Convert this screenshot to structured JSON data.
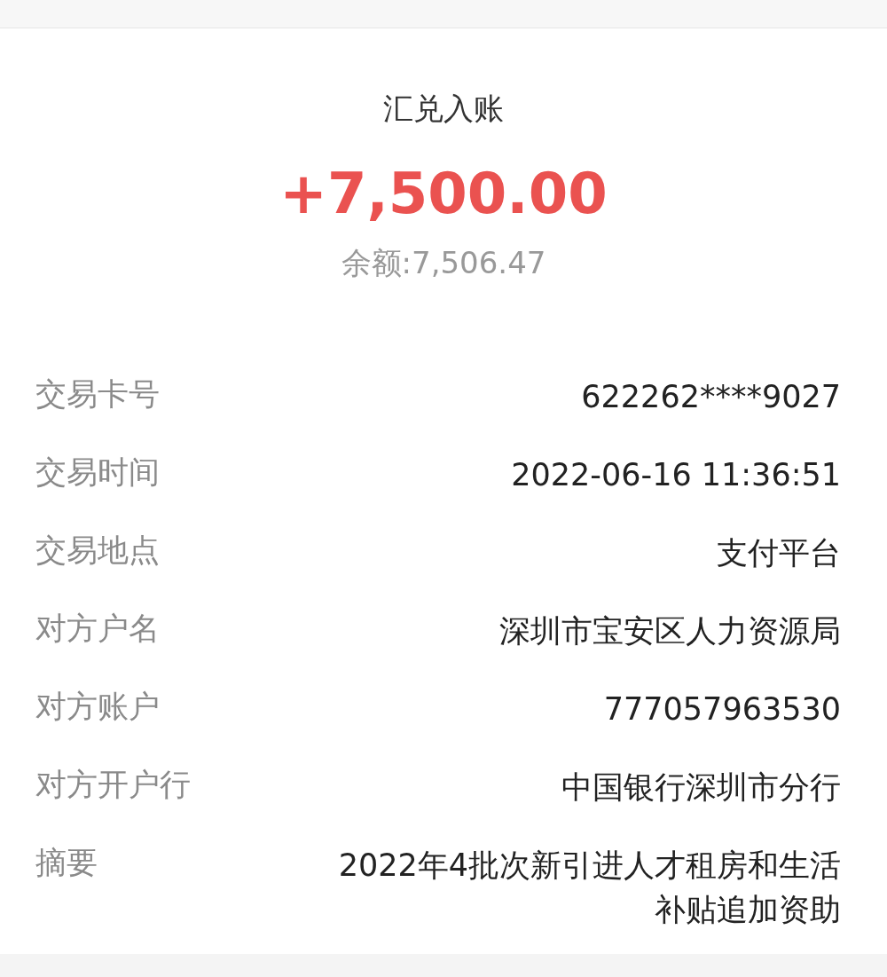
{
  "header": {
    "title": "汇兑入账",
    "amount": "+7,500.00",
    "balance": "余额:7,506.47"
  },
  "details": [
    {
      "label": "交易卡号",
      "value": "622262****9027"
    },
    {
      "label": "交易时间",
      "value": "2022-06-16 11:36:51"
    },
    {
      "label": "交易地点",
      "value": "支付平台"
    },
    {
      "label": "对方户名",
      "value": "深圳市宝安区人力资源局"
    },
    {
      "label": "对方账户",
      "value": "777057963530"
    },
    {
      "label": "对方开户行",
      "value": "中国银行深圳市分行"
    },
    {
      "label": "摘要",
      "value": "2022年4批次新引进人才租房和生活补贴追加资助"
    }
  ]
}
